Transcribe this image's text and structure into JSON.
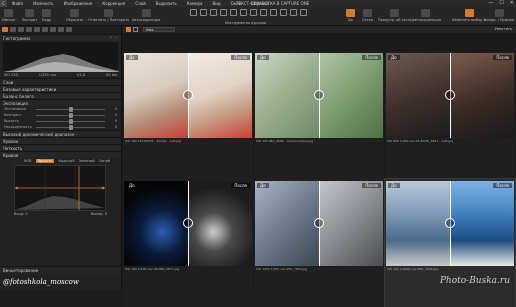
{
  "menubar": {
    "logo": "C",
    "items": [
      "Файл",
      "Изменить",
      "Изображение",
      "Коррекция",
      "Слой",
      "Выделить",
      "Камера",
      "Вид",
      "Окно",
      "Справка"
    ],
    "window_title": "ТЕКСТ-ОБРАБОТКА В CAPTURE ONE",
    "controls": [
      "—",
      "☐",
      "✕"
    ]
  },
  "toolbar": {
    "left": [
      "Импорт",
      "Экспорт",
      "Кадр"
    ],
    "middle": [
      "Сбросить",
      "Отменить / Повторить"
    ],
    "auto": "Автокоррекция",
    "tools_label": "Инструменты курсора",
    "right": [
      "До",
      "Сетка",
      "Предупр. об эксп.",
      "Цветокоррекция",
      "Изменить выбор п.",
      "Копир. / Примен."
    ]
  },
  "left_panel": {
    "histogram_title": "Гистограмма",
    "histogram_values": [
      "ISO 250",
      "1/250 сек",
      "f/1,8",
      "85 мм"
    ],
    "sections": [
      "Слои",
      "Базовые характеристики",
      "Баланс белого",
      "Экспозиция"
    ],
    "exposure_sliders": [
      {
        "label": "Экспозиция",
        "value": "0",
        "level": 0.5
      },
      {
        "label": "Контраст",
        "value": "0",
        "level": 0.5
      },
      {
        "label": "Яркость",
        "value": "0",
        "level": 0.5
      },
      {
        "label": "Насыщенность",
        "value": "0",
        "level": 0.5
      }
    ],
    "sections2": [
      "Высокий динамический диапазон",
      "Уровни",
      "Четкость",
      "Кривая"
    ],
    "curve_tabs": [
      "RGB",
      "Яркость",
      "Красный",
      "Зеленый",
      "Синий"
    ],
    "curve_active": "Яркость",
    "curve_io": {
      "in": "Вход: 0",
      "out": "Выход: 0"
    },
    "bottom_section": "Виньетирование"
  },
  "browser": {
    "select_label": "Имя",
    "sort_label": "Уместить",
    "tiles": [
      {
        "before": "До",
        "after": "После",
        "meta": "ISO 100   25C00758 – Копия – edit.jpg"
      },
      {
        "before": "До",
        "after": "После",
        "meta": "ISO 100   IMG_4589 – Копия-копия.jpg"
      },
      {
        "before": "До",
        "after": "После",
        "meta": "ISO 800   1/250 сек   f/1,8   IMG_5817 – edit.jpg"
      },
      {
        "before": "До",
        "after": "После",
        "meta": "ISO 100   1/100 сек   f/8   IMG_5877.jpg"
      },
      {
        "before": "До",
        "after": "После",
        "meta": "ISO 1250   1/250 сек   IMG_7095.jpg"
      },
      {
        "before": "До",
        "after": "После",
        "meta": "ISO 100   1/4000 сек   IMG_3596.jpg"
      }
    ]
  },
  "watermarks": {
    "left": "@fotoshkola_moscow",
    "right": "Photo-Buska.ru"
  },
  "colors": {
    "accent": "#d67a2b",
    "bg": "#1c1c1c"
  }
}
